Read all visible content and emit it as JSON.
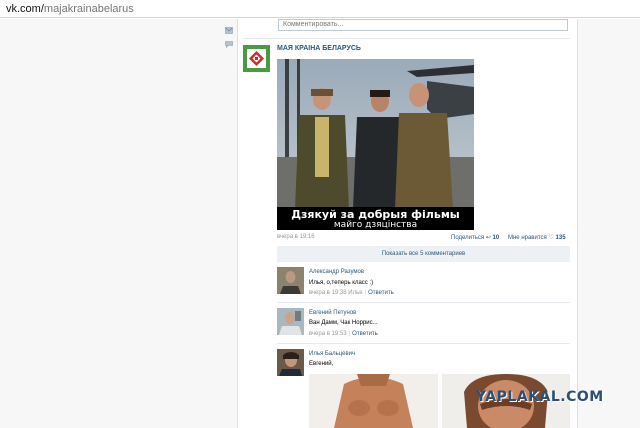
{
  "browser": {
    "url_domain": "vk.com/",
    "url_path": "majakrainabelarus"
  },
  "comment_box": {
    "placeholder": "Комментировать..."
  },
  "post": {
    "author": "МАЯ КРАІНА БЕЛАРУСЬ",
    "image_caption_line1": "Дзякуй за добрыя фільмы",
    "image_caption_line2": "майго дзяцінства",
    "timestamp": "вчера в 19:16",
    "share_label": "Поделиться",
    "share_count": "10",
    "like_label": "Мне нравится",
    "like_count": "135",
    "show_all_comments": "Показать все 5 комментариев"
  },
  "comments": [
    {
      "author": "Александр Разумов",
      "text": "Илья, о,теперь класс :)",
      "time": "вчера в 19:38 Илье",
      "reply": "Ответить"
    },
    {
      "author": "Евгений Петунов",
      "text": "Ван Дамм, Чак Норрис...",
      "time": "вчера в 19:53",
      "reply": "Ответить"
    },
    {
      "author": "Илья Бальцевич",
      "text": "Евгений,"
    }
  ],
  "watermark": "YAPLAKAL.COM",
  "colors": {
    "link": "#2b587a",
    "meta": "#999999",
    "show_all_bg": "#edf1f5"
  },
  "icons": [
    "mail-icon",
    "chat-icon",
    "share-icon",
    "heart-icon"
  ]
}
